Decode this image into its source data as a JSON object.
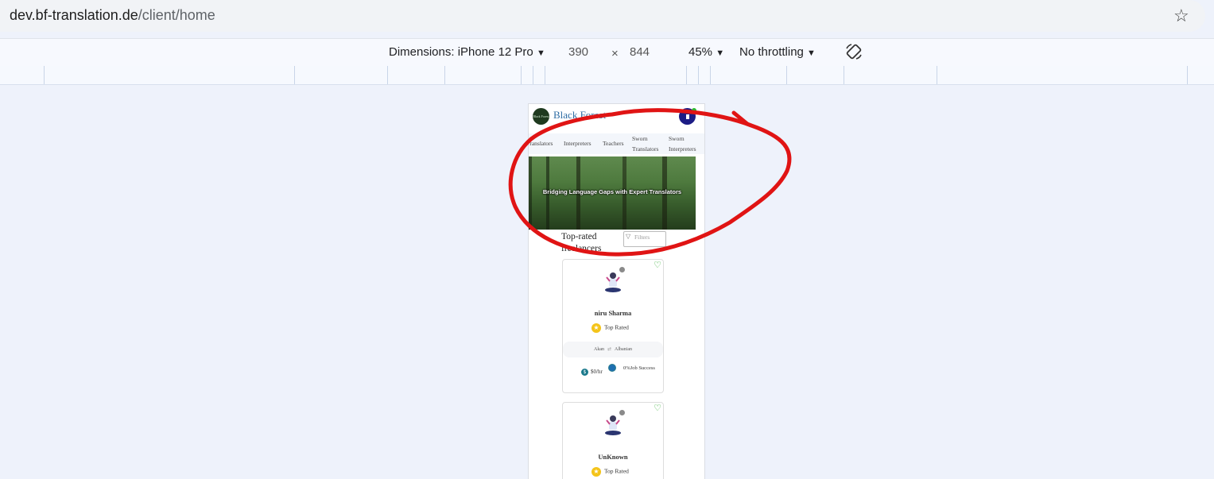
{
  "browser": {
    "url_host": "dev.bf-translation.de",
    "url_path": "/client/home"
  },
  "devtools": {
    "device": "Dimensions: iPhone 12 Pro",
    "width": "390",
    "times": "×",
    "height": "844",
    "zoom": "45%",
    "throttling": "No throttling",
    "dropdown_glyph": "▼"
  },
  "app": {
    "logo_text": "Black Forest",
    "brand": "Black Forest",
    "nav": [
      "Translators",
      "Interpreters",
      "Teachers",
      "Sworn Translators",
      "Sworn Interpreters"
    ],
    "nav_lines": {
      "sworn_a": "Sworn",
      "sworn_a2": "Translators",
      "sworn_b": "Sworn",
      "sworn_b2": "Interpreters"
    },
    "hero_text": "Bridging Language Gaps with Expert Translators",
    "section_title": "Top-rated freelancers",
    "filters_placeholder": "Filters"
  },
  "freelancers": [
    {
      "name": "niru Sharma",
      "badge": "Top Rated",
      "lang_from": "Akan",
      "lang_to": "Albanian",
      "rate": "$0/hr",
      "job_success": "0%Job Success"
    },
    {
      "name": "UnKnown",
      "badge": "Top Rated"
    }
  ],
  "colors": {
    "brand": "#2e6da4",
    "favorite": "#2eab2e",
    "annotation": "#e01414"
  },
  "icons": [
    "star-icon",
    "dropdown-icon",
    "rotate-icon",
    "filter-icon",
    "heart-icon",
    "star-badge-icon",
    "dollar-icon",
    "shield-icon",
    "swap-icon"
  ]
}
